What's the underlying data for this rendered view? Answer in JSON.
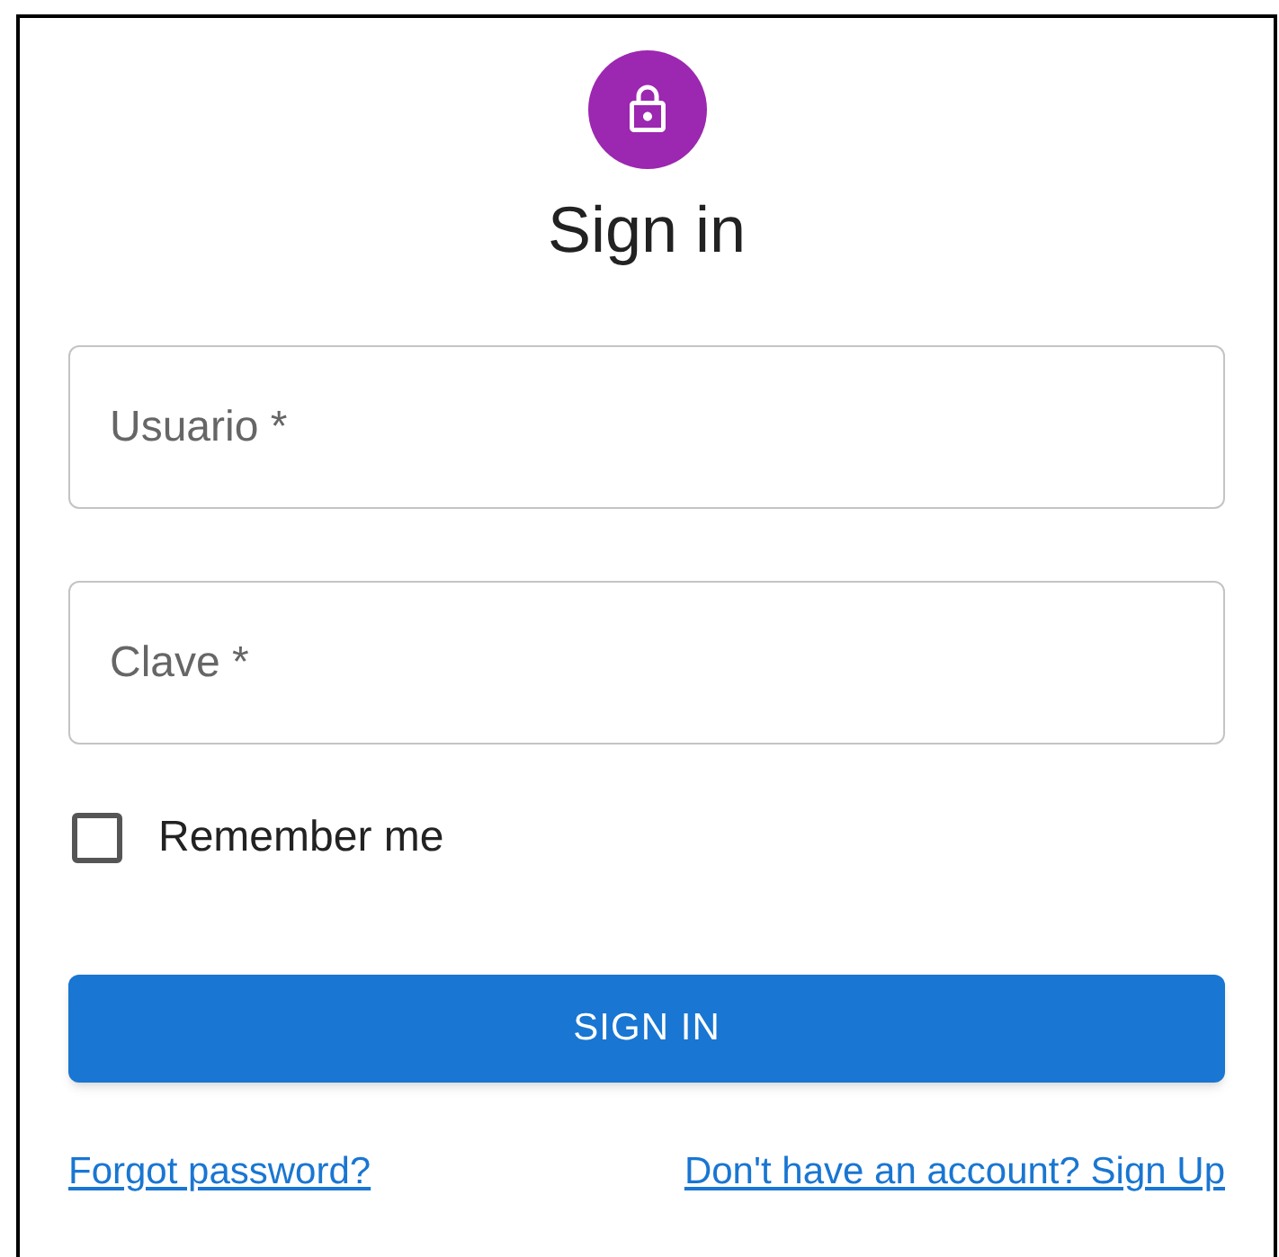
{
  "title": "Sign in",
  "fields": [
    {
      "label": "Usuario *"
    },
    {
      "label": "Clave *"
    }
  ],
  "remember": {
    "label": "Remember me",
    "checked": false
  },
  "button": "SIGN IN",
  "links": [
    "Forgot password?",
    "Don't have an account? Sign Up"
  ]
}
